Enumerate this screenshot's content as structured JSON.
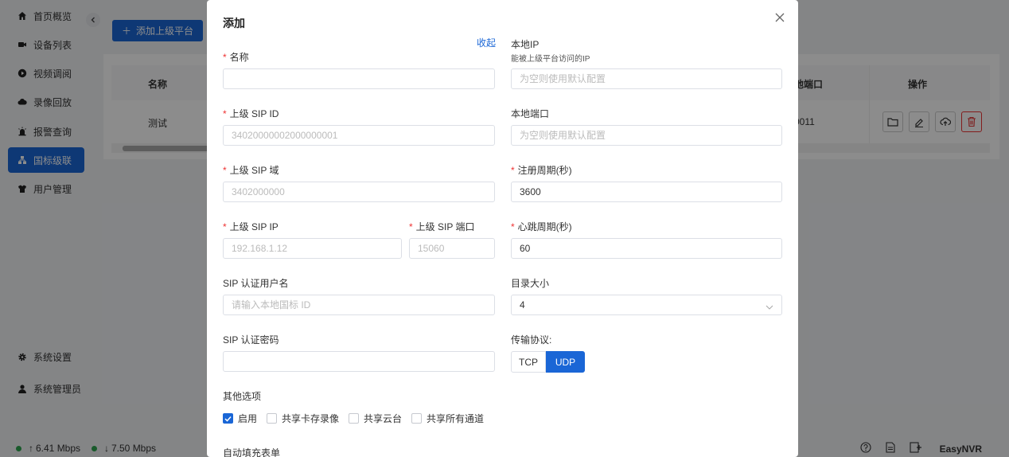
{
  "sidebar": {
    "collapse_icon": "chevron-left-icon",
    "items": [
      {
        "label": "首页概览",
        "icon": "home-icon"
      },
      {
        "label": "设备列表",
        "icon": "camera-icon"
      },
      {
        "label": "视频调阅",
        "icon": "play-icon"
      },
      {
        "label": "录像回放",
        "icon": "cloud-icon"
      },
      {
        "label": "报警查询",
        "icon": "alarm-icon"
      },
      {
        "label": "国标级联",
        "icon": "cascade-icon",
        "active": true
      },
      {
        "label": "用户管理",
        "icon": "users-icon"
      }
    ],
    "bottom": [
      {
        "label": "系统设置",
        "icon": "gear-icon"
      },
      {
        "label": "系统管理员",
        "icon": "user-icon"
      }
    ]
  },
  "main": {
    "add_button": "添加上级平台",
    "table": {
      "headers": {
        "name": "名称",
        "local_port": "地端口",
        "actions": "操作"
      },
      "rows": [
        {
          "name": "测试",
          "local_port": "0011"
        }
      ]
    }
  },
  "statusbar": {
    "upload": "6.41 Mbps",
    "download": "7.50 Mbps",
    "brand": "EasyNVR"
  },
  "dialog": {
    "title": "添加",
    "collapse": "收起",
    "required_mark": "*",
    "fields": {
      "name": {
        "label": "名称",
        "value": "",
        "placeholder": ""
      },
      "sip_id": {
        "label": "上级 SIP ID",
        "placeholder": "34020000002000000001"
      },
      "sip_domain": {
        "label": "上级 SIP 域",
        "placeholder": "3402000000"
      },
      "sip_ip": {
        "label": "上级 SIP IP",
        "placeholder": "192.168.1.12"
      },
      "sip_port": {
        "label": "上级 SIP 端口",
        "placeholder": "15060"
      },
      "auth_user": {
        "label": "SIP 认证用户名",
        "placeholder": "请输入本地国标 ID"
      },
      "auth_password": {
        "label": "SIP 认证密码",
        "placeholder": ""
      },
      "local_ip": {
        "label": "本地IP",
        "hint": "能被上级平台访问的IP",
        "placeholder": "为空则使用默认配置"
      },
      "local_port": {
        "label": "本地端口",
        "placeholder": "为空则使用默认配置"
      },
      "register_period": {
        "label": "注册周期(秒)",
        "value": "3600"
      },
      "heartbeat_period": {
        "label": "心跳周期(秒)",
        "value": "60"
      },
      "catalog_size": {
        "label": "目录大小",
        "value": "4"
      },
      "transport": {
        "label": "传输协议:",
        "options": [
          "TCP",
          "UDP"
        ],
        "selected": "UDP"
      }
    },
    "other_options": {
      "label": "其他选项",
      "checkboxes": [
        {
          "label": "启用",
          "checked": true
        },
        {
          "label": "共享卡存录像",
          "checked": false
        },
        {
          "label": "共享云台",
          "checked": false
        },
        {
          "label": "共享所有通道",
          "checked": false
        }
      ]
    },
    "autofill_label": "自动填充表单"
  },
  "colors": {
    "primary": "#1a66d6",
    "danger": "#e33333",
    "online": "#2ea44f"
  }
}
